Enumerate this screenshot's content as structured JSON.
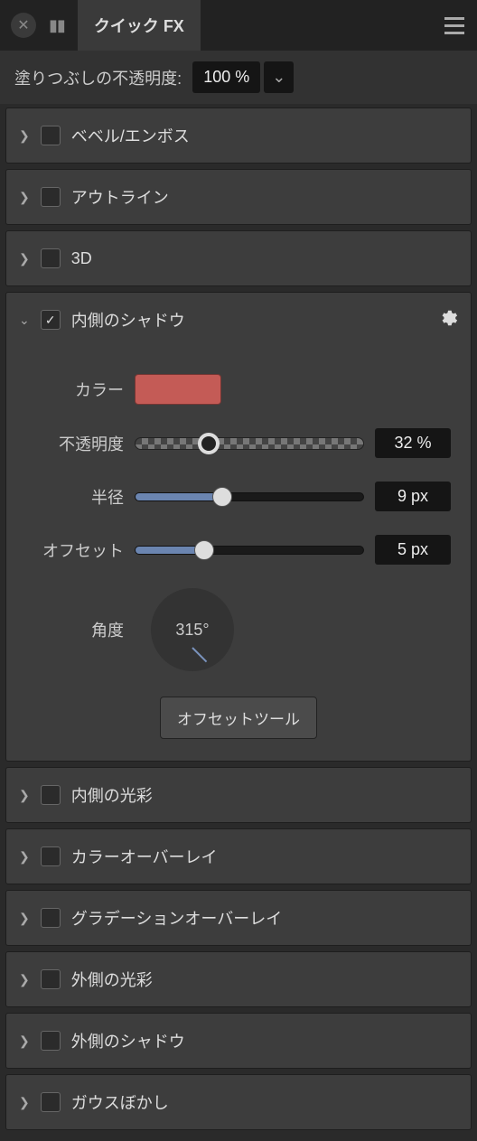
{
  "panel": {
    "title": "クイック FX"
  },
  "toolbar": {
    "fill_opacity_label": "塗りつぶしの不透明度:",
    "fill_opacity_value": "100 %"
  },
  "sections": [
    {
      "id": "bevel",
      "label": "ベベル/エンボス",
      "checked": false,
      "expanded": false
    },
    {
      "id": "outline",
      "label": "アウトライン",
      "checked": false,
      "expanded": false
    },
    {
      "id": "3d",
      "label": "3D",
      "checked": false,
      "expanded": false
    },
    {
      "id": "inner_shadow",
      "label": "内側のシャドウ",
      "checked": true,
      "expanded": true
    },
    {
      "id": "inner_glow",
      "label": "内側の光彩",
      "checked": false,
      "expanded": false
    },
    {
      "id": "color_overlay",
      "label": "カラーオーバーレイ",
      "checked": false,
      "expanded": false
    },
    {
      "id": "gradient_overlay",
      "label": "グラデーションオーバーレイ",
      "checked": false,
      "expanded": false
    },
    {
      "id": "outer_glow",
      "label": "外側の光彩",
      "checked": false,
      "expanded": false
    },
    {
      "id": "drop_shadow",
      "label": "外側のシャドウ",
      "checked": false,
      "expanded": false
    },
    {
      "id": "gaussian_blur",
      "label": "ガウスぼかし",
      "checked": false,
      "expanded": false
    }
  ],
  "inner_shadow": {
    "color_label": "カラー",
    "color_value": "#c45b56",
    "opacity_label": "不透明度",
    "opacity_value": "32 %",
    "opacity_pct": 32,
    "radius_label": "半径",
    "radius_value": "9 px",
    "radius_pct": 38,
    "offset_label": "オフセット",
    "offset_value": "5 px",
    "offset_pct": 30,
    "angle_label": "角度",
    "angle_value": "315°",
    "tool_button": "オフセットツール"
  }
}
